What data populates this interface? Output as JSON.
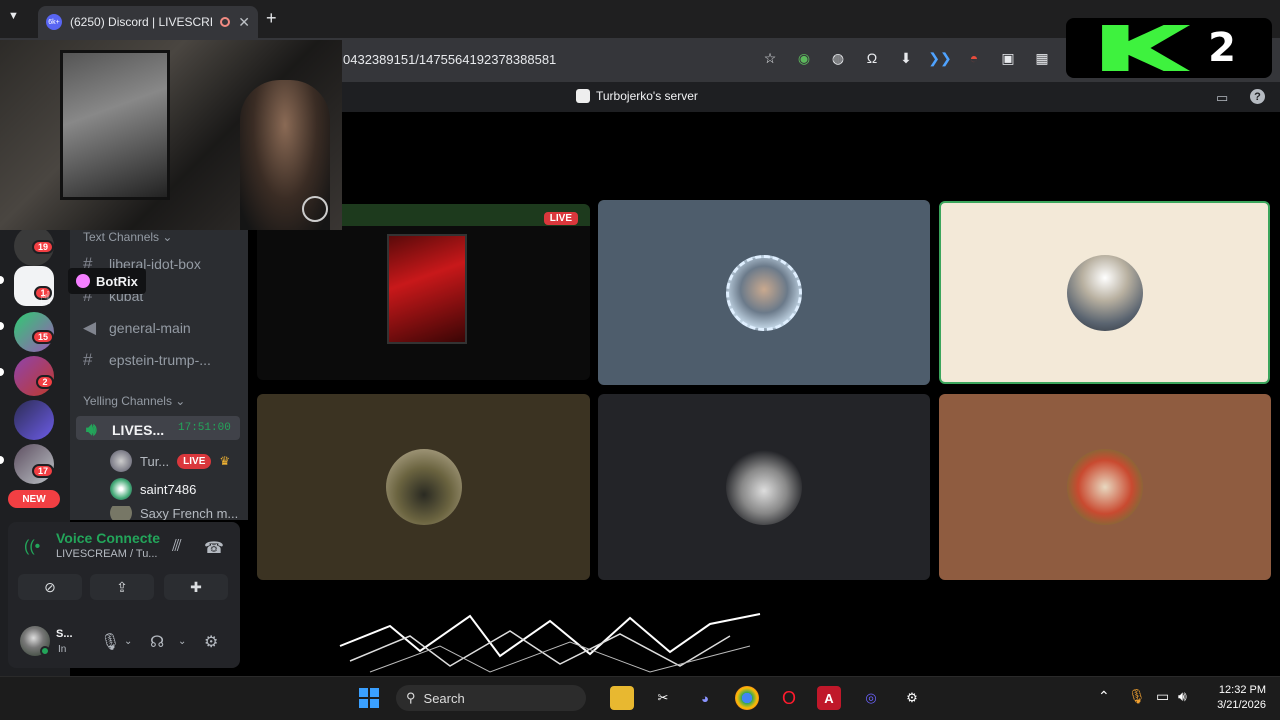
{
  "browser": {
    "tab_title": "(6250) Discord | LIVESCREA",
    "tab_badge": "6k+",
    "url": "0432389151/1475564192378388581",
    "new_tab": "+",
    "close": "✕"
  },
  "discord": {
    "server_name": "Turbojerko's server",
    "tooltip": "BotRix",
    "categories": {
      "text": "Text Channels",
      "voice": "Yelling Channels"
    },
    "text_channels": [
      "liberal-idot-box",
      "kubat",
      "general-main",
      "epstein-trump-..."
    ],
    "voice_channel": "LIVES...",
    "voice_timer": "17:51:00",
    "voice_users": [
      {
        "name": "Tur...",
        "live": "LIVE"
      },
      {
        "name": "saint7486"
      },
      {
        "name": "Saxy French m..."
      }
    ],
    "rail_badges": [
      "19",
      "1",
      "15",
      "2",
      "17"
    ],
    "new_label": "NEW",
    "voice_panel": {
      "status": "Voice Connecte",
      "sub": "LIVESCREAM / Tu...",
      "user_name": "S...",
      "user_status": "In"
    }
  },
  "stage": {
    "live_label": "LIVE"
  },
  "overlay": {
    "k2_number": "2"
  },
  "taskbar": {
    "search": "Search",
    "time": "12:32 PM",
    "date": "3/21/2026"
  },
  "colors": {
    "discord_green": "#23a55a",
    "live_red": "#da373c",
    "k2_green": "#3ef23e",
    "speaking_border": "#3ba55c"
  }
}
